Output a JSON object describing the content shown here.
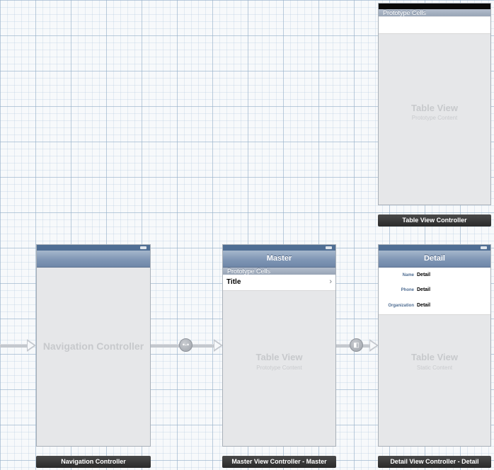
{
  "prototype_cells_label": "Prototype Cells",
  "table_view_controller": {
    "table_view_label": "Table View",
    "content_label": "Prototype Content",
    "caption": "Table View Controller"
  },
  "navigation_controller": {
    "center_label": "Navigation Controller",
    "caption": "Navigation Controller"
  },
  "master_view_controller": {
    "nav_title": "Master",
    "section_header": "Prototype Cells",
    "cell_title": "Title",
    "table_view_label": "Table View",
    "content_label": "Prototype Content",
    "caption": "Master View Controller - Master"
  },
  "detail_view_controller": {
    "nav_title": "Detail",
    "rows": [
      {
        "key": "Name",
        "value": "Detail"
      },
      {
        "key": "Phone",
        "value": "Detail"
      },
      {
        "key": "Organization",
        "value": "Detail"
      }
    ],
    "table_view_label": "Table View",
    "content_label": "Static Content",
    "caption": "Detail View Controller - Detail"
  },
  "segue_icons": {
    "relationship": "relationship-segue-icon",
    "push": "push-segue-icon"
  }
}
